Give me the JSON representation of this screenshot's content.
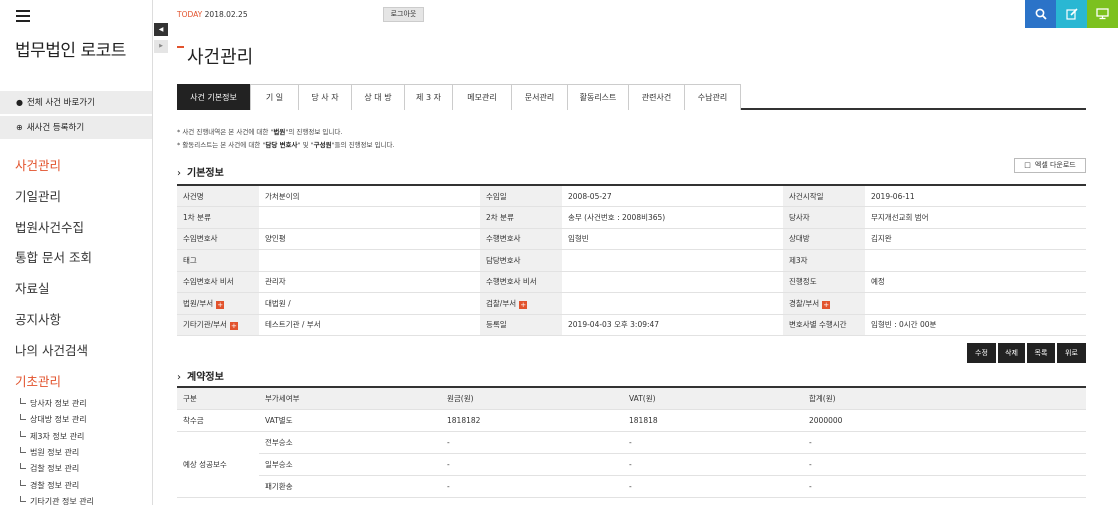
{
  "sidebar": {
    "logo": "법무법인 로코트",
    "btn_all_cases": "전체 사건 바로가기",
    "btn_new_case": "새사건 등록하기",
    "menu": [
      {
        "label": "사건관리",
        "active": true
      },
      {
        "label": "기일관리",
        "active": false
      },
      {
        "label": "법원사건수집",
        "active": false
      },
      {
        "label": "통합 문서 조회",
        "active": false
      },
      {
        "label": "자료실",
        "active": false
      },
      {
        "label": "공지사항",
        "active": false
      },
      {
        "label": "나의 사건검색",
        "active": false
      },
      {
        "label": "기초관리",
        "active": true
      }
    ],
    "submenu": [
      "당사자 정보 관리",
      "상대방 정보 관리",
      "제3자 정보 관리",
      "법원 정보 관리",
      "검찰 정보 관리",
      "경찰 정보 관리",
      "기타기관 정보 관리"
    ]
  },
  "header": {
    "today_label": "TODAY",
    "today_date": "2018.02.25",
    "logout": "로그아웃",
    "icons": [
      {
        "name": "search-icon",
        "color": "#2b73c8"
      },
      {
        "name": "edit-icon",
        "color": "#29b7d3"
      },
      {
        "name": "monitor-icon",
        "color": "#7cc11f"
      }
    ]
  },
  "page_title": "사건관리",
  "tabs": [
    "사건 기본정보",
    "기 일",
    "당 사 자",
    "상 대 방",
    "제 3 자",
    "메모관리",
    "문서관리",
    "활동리스트",
    "관련사건",
    "수납관리"
  ],
  "notes": {
    "line1_pre": "* 사건 진행내역은 본 사건에 대한 \"",
    "line1_bold": "법원",
    "line1_post": "\"의 진행정보 입니다.",
    "line2_pre": "* 활동리스트는 본 사건에 대한 \"",
    "line2_bold1": "담당 변호사",
    "line2_mid": "\" 및 \"",
    "line2_bold2": "구성원",
    "line2_post": "\"들의 진행정보 입니다."
  },
  "basic_info": {
    "title": "기본정보",
    "excel_button": "엑셀 다운로드",
    "rows": [
      [
        "사건명",
        "가처분이의",
        "수임일",
        "2008-05-27",
        "사건시작일",
        "2019-06-11"
      ],
      [
        "1차 분류",
        "",
        "2차 분류",
        "송무 (사건번호 : 2008비365)",
        "당사자",
        "무지개선교회 범어"
      ],
      [
        "수임변호사",
        "양인평",
        "수행변호사",
        "임형빈",
        "상대방",
        "김지완"
      ],
      [
        "태그",
        "",
        "담당변호사",
        "",
        "제3자",
        ""
      ],
      [
        "수임변호사 비서",
        "관리자",
        "수행변호사 비서",
        "",
        "진행정도",
        "예정"
      ],
      [
        "법원/부서",
        "대법원 /",
        "검찰/부서",
        "",
        "경찰/부서",
        ""
      ],
      [
        "기타기관/부서",
        "테스트기관 / 부서",
        "등록일",
        "2019-04-03 오후 3:09:47",
        "변호사별 수행시간",
        "임형빈 : 0시간 00분"
      ]
    ],
    "plus_labels": [
      "법원/부서",
      "검찰/부서",
      "경찰/부서",
      "기타기관/부서"
    ]
  },
  "actions": [
    "수정",
    "삭제",
    "목록",
    "위로"
  ],
  "contract_info": {
    "title": "계약정보",
    "headers": [
      "구분",
      "부가세여부",
      "원금(원)",
      "VAT(원)",
      "합계(원)"
    ],
    "row1": [
      "착수금",
      "VAT별도",
      "1818182",
      "181818",
      "2000000"
    ],
    "group_label": "예상 성공보수",
    "group_rows": [
      [
        "전부승소",
        "-",
        "-",
        "-"
      ],
      [
        "일부승소",
        "-",
        "-",
        "-"
      ],
      [
        "패기환송",
        "-",
        "-",
        "-"
      ]
    ]
  }
}
